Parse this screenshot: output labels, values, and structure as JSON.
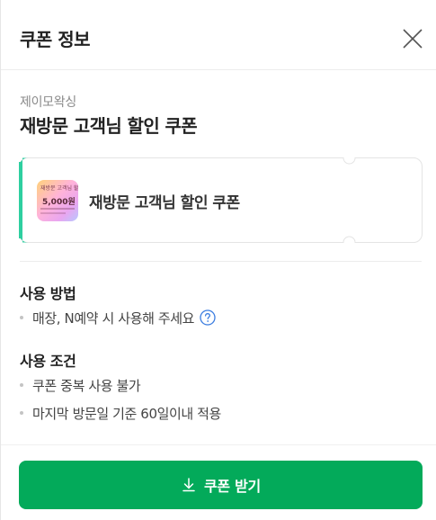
{
  "header": {
    "title": "쿠폰 정보",
    "close_icon": "close-icon"
  },
  "coupon": {
    "store_name": "제이모왁싱",
    "title": "재방문 고객님 할인 쿠폰",
    "ticket": {
      "name": "재방문 고객님 할인 쿠폰",
      "thumbnail": {
        "line1": "재방문 고객님 할인 쿠폰",
        "amount": "5,000원"
      },
      "accent_color": "#2ecfa0"
    }
  },
  "usage": {
    "title": "사용 방법",
    "items": [
      {
        "text": "매장, N예약 시 사용해 주세요",
        "icon": "help-circle-icon"
      }
    ]
  },
  "conditions": {
    "title": "사용 조건",
    "items": [
      {
        "text": "쿠폰 중복 사용 불가"
      },
      {
        "text": "마지막 방문일 기준 60일이내 적용"
      }
    ]
  },
  "cta": {
    "label": "쿠폰 받기",
    "icon": "download-icon",
    "color": "#03aa5a"
  }
}
